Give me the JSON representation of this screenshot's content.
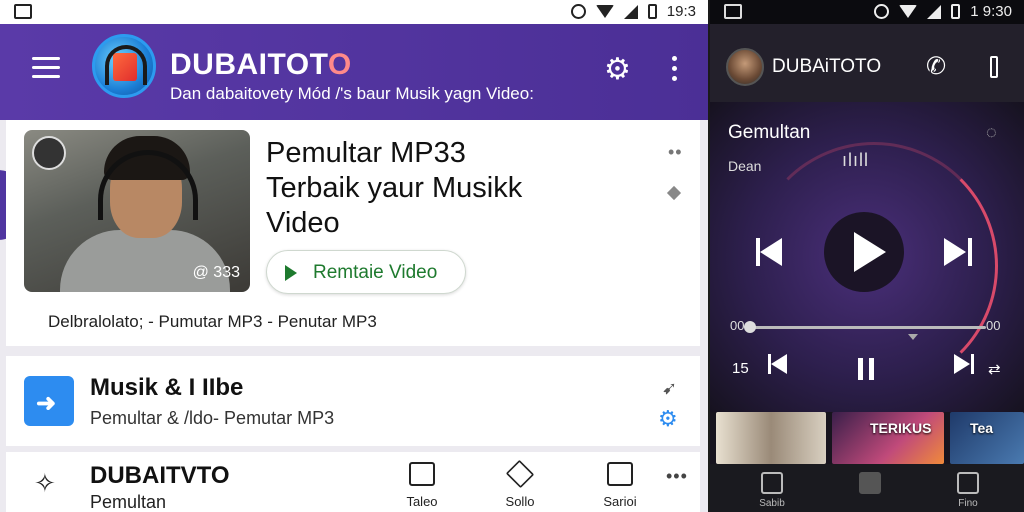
{
  "left_status": {
    "time": "19:3"
  },
  "appbar": {
    "title_main": "DUBAITOT",
    "title_o": "O",
    "subtitle": "Dan dabaitovety Mód /'s baur Musik yagn Video:"
  },
  "hero": {
    "title": "Pemultar MP33 Terbaik yaur Musikk Video",
    "button_label": "Remtaie Video",
    "photo_tag": "@ 333",
    "caption": "Delbralolato; - Pumutar MP3 - Penutar MP3"
  },
  "card2": {
    "title": "Musik & I IIbe",
    "subtitle": "Pemultar & /ldo- Pemutar MP3"
  },
  "bottom": {
    "title": "DUBAITVTO",
    "subtitle": "Pemultan",
    "nav": [
      {
        "label": "Taleo",
        "icon": "library-icon"
      },
      {
        "label": "Sollo",
        "icon": "share-icon"
      },
      {
        "label": "Sarioi",
        "icon": "message-icon"
      }
    ]
  },
  "right_status": {
    "time": "1 9:30"
  },
  "right_head": {
    "title": "DUBAiTOTO"
  },
  "player": {
    "title": "Gemultan",
    "sub": "Dean",
    "eq": "ılıll",
    "seek_left": "00",
    "seek_right": "00",
    "count": "15",
    "repeat": "⇄"
  },
  "thumbs": [
    {
      "label": ""
    },
    {
      "label": "TERIKUS"
    },
    {
      "label": "Tea"
    }
  ],
  "right_nav": [
    {
      "label": "Sabib",
      "icon": "home-icon"
    },
    {
      "label": "",
      "icon": "square-icon"
    },
    {
      "label": "Fino",
      "icon": "search-icon"
    }
  ]
}
